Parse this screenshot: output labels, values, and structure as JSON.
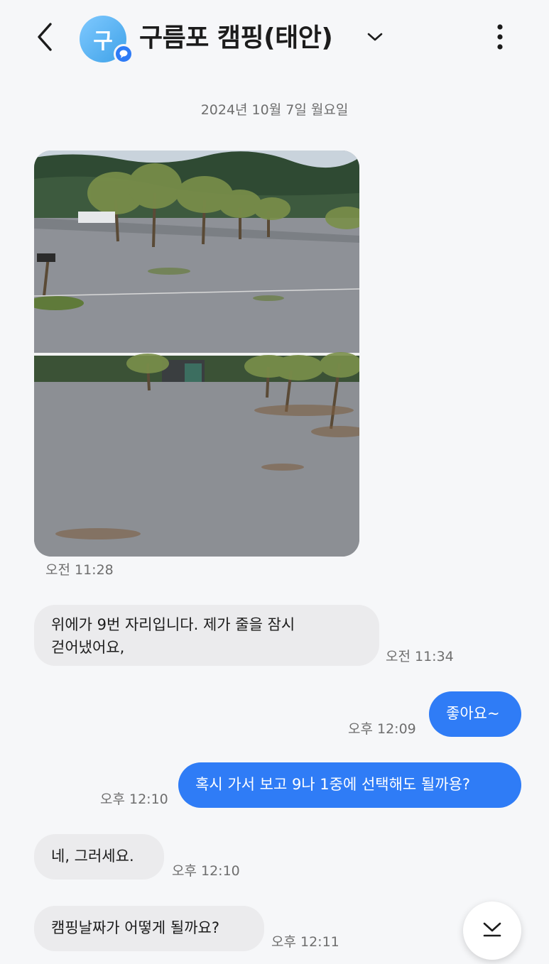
{
  "header": {
    "avatar_initial": "구",
    "title": "구름포 캠핑(태안)",
    "back_icon": "chevron-left-icon",
    "dropdown_icon": "chevron-down-icon",
    "more_icon": "more-vertical-icon"
  },
  "date_separator": "2024년 10월 7일 월요일",
  "messages": [
    {
      "side": "in",
      "type": "image",
      "time": "오전 11:28"
    },
    {
      "side": "in",
      "type": "text",
      "line1": "위에가 9번 자리입니다. 제가 줄을 잠시",
      "line2": "걷어냈어요,",
      "time": "오전 11:34"
    },
    {
      "side": "out",
      "type": "text",
      "text": "좋아요~",
      "time": "오후 12:09"
    },
    {
      "side": "out",
      "type": "text",
      "text": "혹시 가서 보고 9나 1중에 선택해도 될까용?",
      "time": "오후 12:10"
    },
    {
      "side": "in",
      "type": "text",
      "text": "네, 그러세요.",
      "time": "오후 12:10"
    },
    {
      "side": "in",
      "type": "text",
      "text": "캠핑날짜가 어떻게 될까요?",
      "time": "오후 12:11"
    }
  ],
  "scroll_button_icon": "chevron-down-icon",
  "colors": {
    "background": "#f6f7f9",
    "outgoing_bubble": "#2f7cf6",
    "incoming_bubble": "#ebebed",
    "avatar": "#4aa8ec",
    "badge": "#2e7bf6"
  }
}
